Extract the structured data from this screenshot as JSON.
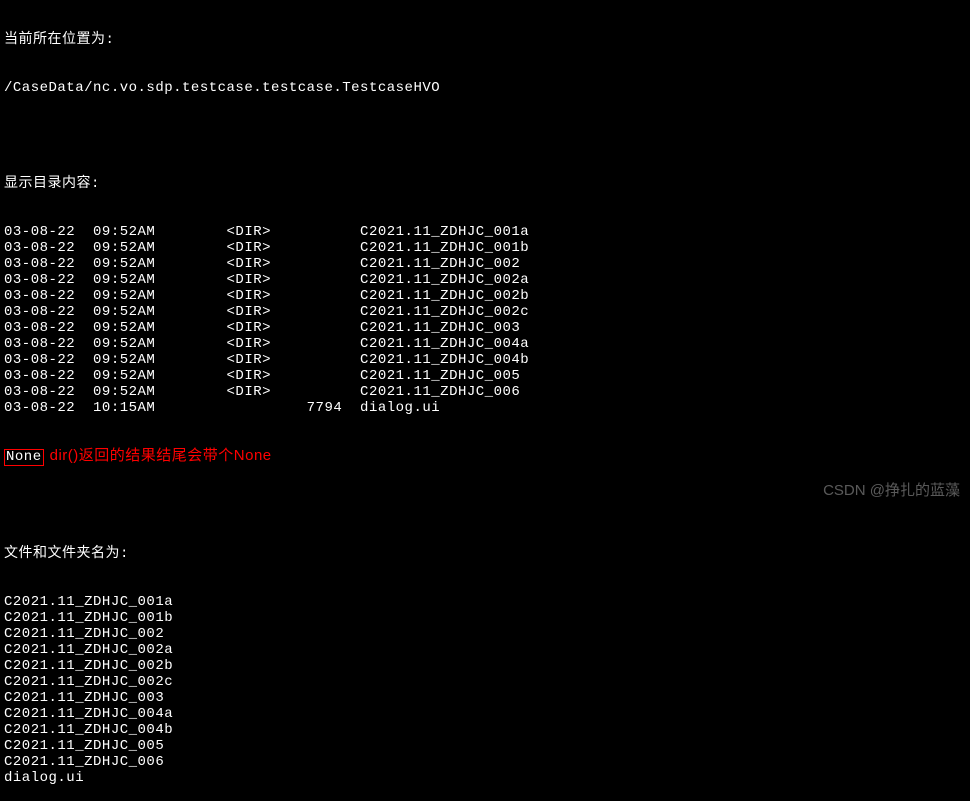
{
  "header": {
    "location_label": "当前所在位置为:",
    "location_path": "/CaseData/nc.vo.sdp.testcase.testcase.TestcaseHVO"
  },
  "dir_listing": {
    "title": "显示目录内容:",
    "rows": [
      {
        "date": "03-08-22",
        "time": "09:52AM",
        "type": "<DIR>",
        "name": "C2021.11_ZDHJC_001a"
      },
      {
        "date": "03-08-22",
        "time": "09:52AM",
        "type": "<DIR>",
        "name": "C2021.11_ZDHJC_001b"
      },
      {
        "date": "03-08-22",
        "time": "09:52AM",
        "type": "<DIR>",
        "name": "C2021.11_ZDHJC_002"
      },
      {
        "date": "03-08-22",
        "time": "09:52AM",
        "type": "<DIR>",
        "name": "C2021.11_ZDHJC_002a"
      },
      {
        "date": "03-08-22",
        "time": "09:52AM",
        "type": "<DIR>",
        "name": "C2021.11_ZDHJC_002b"
      },
      {
        "date": "03-08-22",
        "time": "09:52AM",
        "type": "<DIR>",
        "name": "C2021.11_ZDHJC_002c"
      },
      {
        "date": "03-08-22",
        "time": "09:52AM",
        "type": "<DIR>",
        "name": "C2021.11_ZDHJC_003"
      },
      {
        "date": "03-08-22",
        "time": "09:52AM",
        "type": "<DIR>",
        "name": "C2021.11_ZDHJC_004a"
      },
      {
        "date": "03-08-22",
        "time": "09:52AM",
        "type": "<DIR>",
        "name": "C2021.11_ZDHJC_004b"
      },
      {
        "date": "03-08-22",
        "time": "09:52AM",
        "type": "<DIR>",
        "name": "C2021.11_ZDHJC_005"
      },
      {
        "date": "03-08-22",
        "time": "09:52AM",
        "type": "<DIR>",
        "name": "C2021.11_ZDHJC_006"
      },
      {
        "date": "03-08-22",
        "time": "10:15AM",
        "type": "",
        "size": "7794",
        "name": "dialog.ui"
      }
    ],
    "none_value": "None",
    "annotation": "dir()返回的结果结尾会带个None"
  },
  "file_names": {
    "title": "文件和文件夹名为:",
    "items": [
      "C2021.11_ZDHJC_001a",
      "C2021.11_ZDHJC_001b",
      "C2021.11_ZDHJC_002",
      "C2021.11_ZDHJC_002a",
      "C2021.11_ZDHJC_002b",
      "C2021.11_ZDHJC_002c",
      "C2021.11_ZDHJC_003",
      "C2021.11_ZDHJC_004a",
      "C2021.11_ZDHJC_004b",
      "C2021.11_ZDHJC_005",
      "C2021.11_ZDHJC_006",
      "dialog.ui"
    ]
  },
  "watermark": "CSDN @挣扎的蓝藻"
}
